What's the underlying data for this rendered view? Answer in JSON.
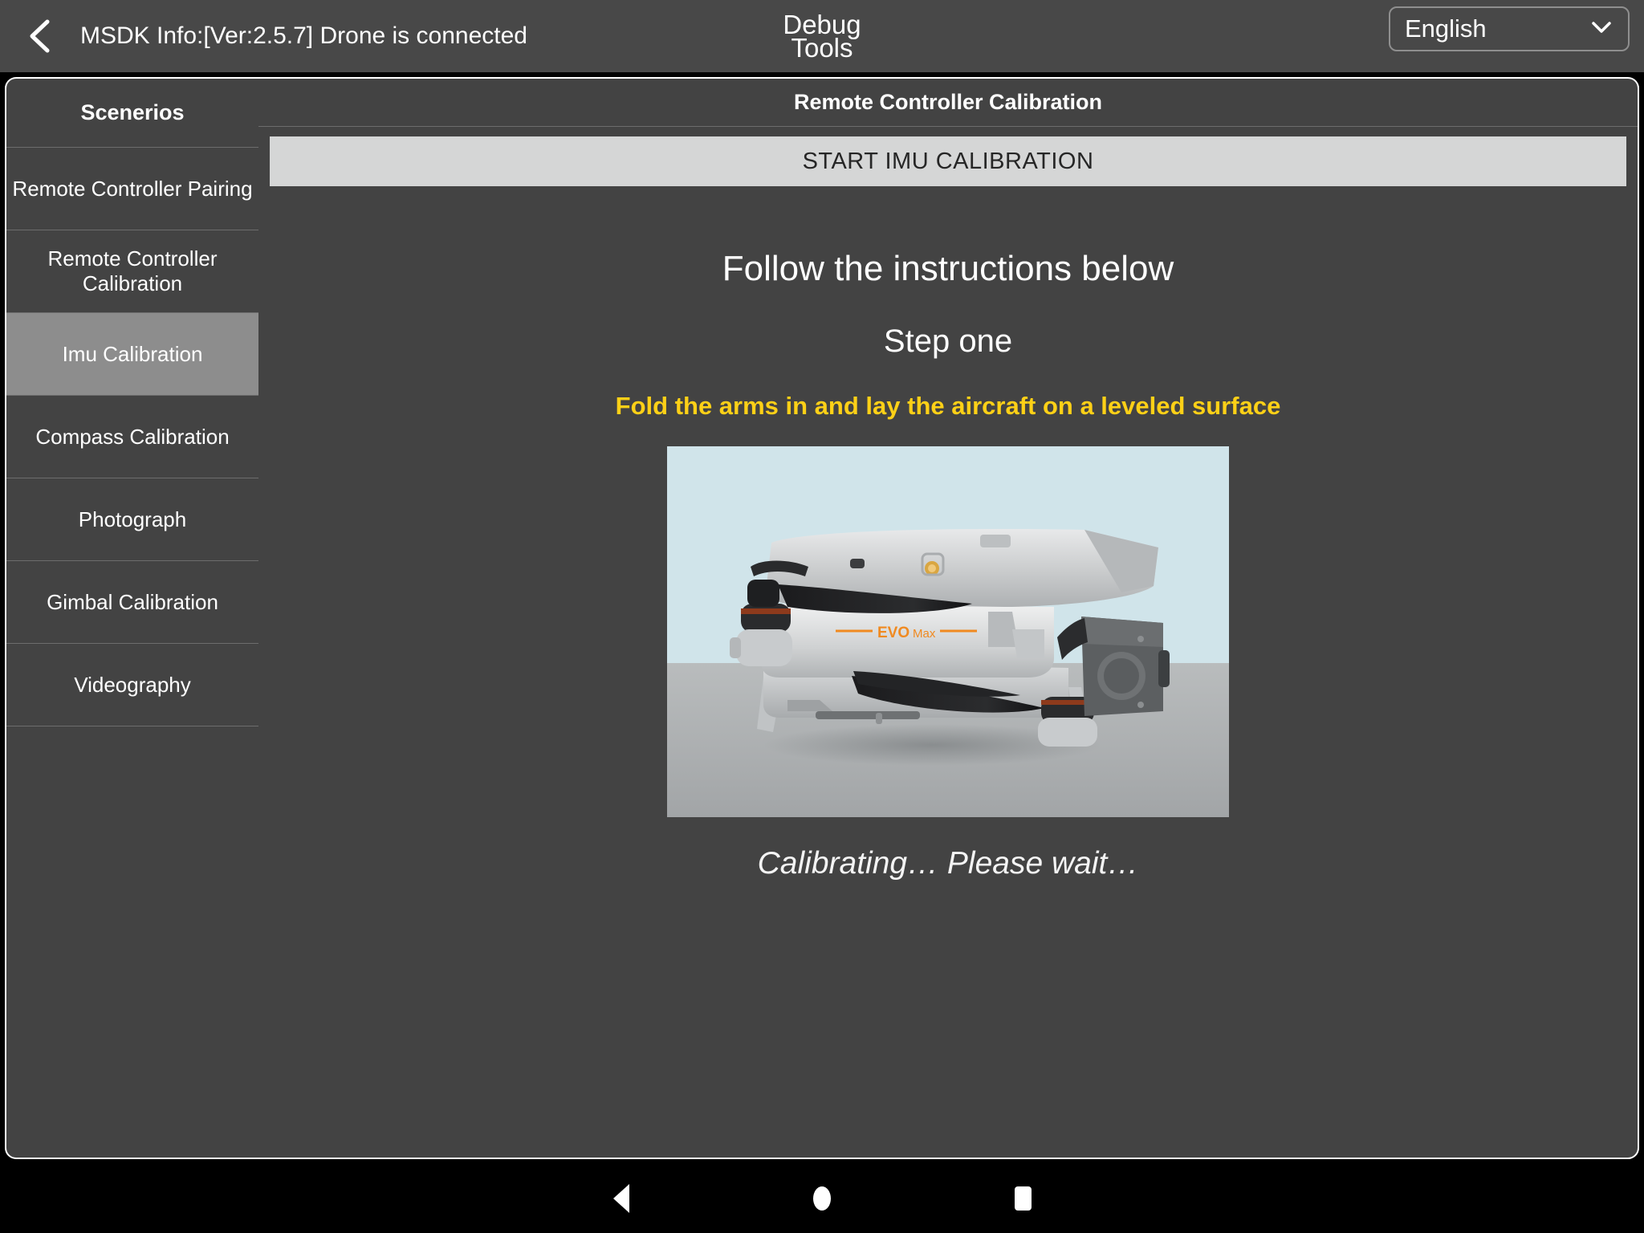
{
  "topbar": {
    "back_icon": "chevron-left-icon",
    "msdk_info": "MSDK Info:[Ver:2.5.7] Drone is connected",
    "title_line1": "Debug",
    "title_line2": "Tools",
    "language": "English",
    "language_chevron": "chevron-down-icon"
  },
  "sidebar": {
    "title": "Scenerios",
    "items": [
      {
        "label": "Remote Controller Pairing",
        "active": false
      },
      {
        "label": "Remote Controller Calibration",
        "active": false
      },
      {
        "label": "Imu Calibration",
        "active": true
      },
      {
        "label": "Compass Calibration",
        "active": false
      },
      {
        "label": "Photograph",
        "active": false
      },
      {
        "label": "Gimbal Calibration",
        "active": false
      },
      {
        "label": "Videography",
        "active": false
      }
    ]
  },
  "panel": {
    "title": "Remote Controller Calibration",
    "start_button": "START IMU CALIBRATION",
    "instructions_heading": "Follow the instructions below",
    "step_heading": "Step one",
    "step_detail": "Fold the arms in and lay the aircraft on a leveled surface",
    "status": "Calibrating… Please wait…",
    "image_alt": "drone-folded-arms-illustration",
    "drone_brand": "EVO",
    "drone_model": "Max"
  },
  "navbar": {
    "back": "nav-back-icon",
    "home": "nav-home-icon",
    "recents": "nav-recents-icon"
  },
  "colors": {
    "accent_yellow": "#fdd017",
    "panel_bg": "#434343",
    "active_item": "#8d8d8d",
    "button_bg": "#d5d6d6",
    "drone_orange": "#f08a20"
  }
}
